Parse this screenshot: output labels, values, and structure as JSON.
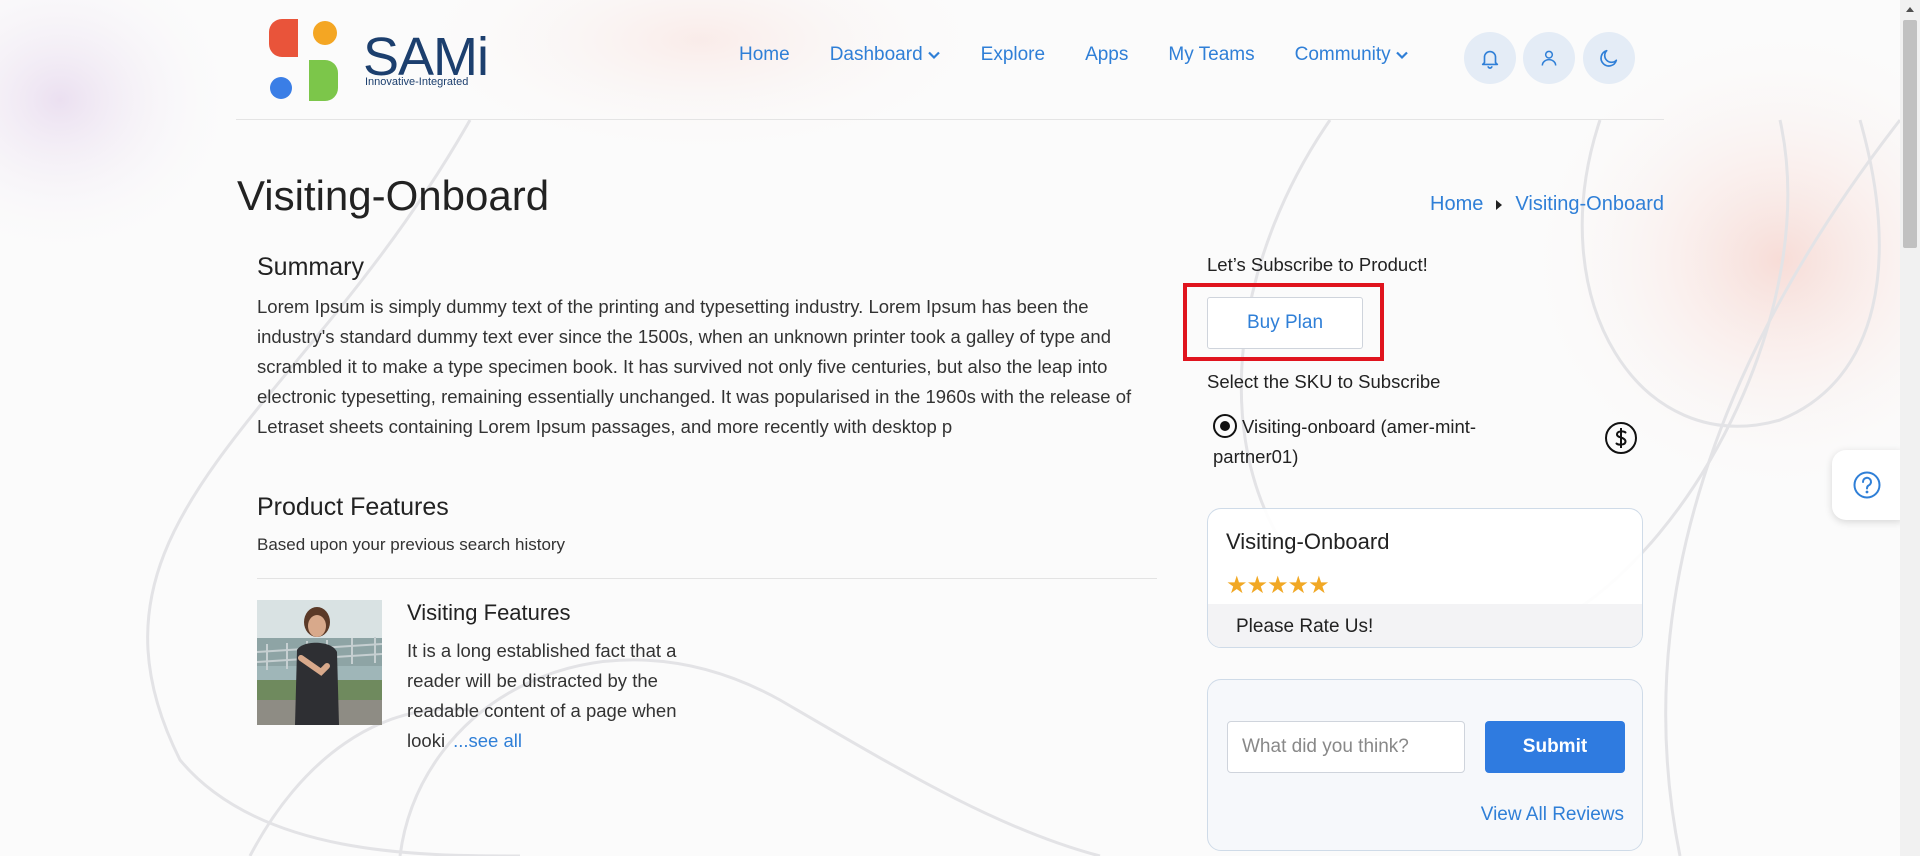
{
  "header": {
    "brand": "SAMi",
    "tagline": "Innovative-Integrated",
    "nav": [
      {
        "label": "Home"
      },
      {
        "label": "Dashboard"
      },
      {
        "label": "Explore"
      },
      {
        "label": "Apps"
      },
      {
        "label": "My Teams"
      },
      {
        "label": "Community"
      }
    ],
    "icons": [
      "bell-icon",
      "user-icon",
      "moon-icon"
    ]
  },
  "page": {
    "title": "Visiting-Onboard",
    "breadcrumb": [
      "Home",
      "Visiting-Onboard"
    ]
  },
  "summary": {
    "heading": "Summary",
    "text": "Lorem Ipsum is simply dummy text of the printing and typesetting industry. Lorem Ipsum has been the industry's standard dummy text ever since the 1500s, when an unknown printer took a galley of type and scrambled it to make a type specimen book. It has survived not only five centuries, but also the leap into electronic typesetting, remaining essentially unchanged. It was popularised in the 1960s with the release of Letraset sheets containing Lorem Ipsum passages, and more recently with desktop p"
  },
  "features": {
    "heading": "Product Features",
    "subheading": "Based upon your previous search history",
    "items": [
      {
        "title": "Visiting Features",
        "text": "It is a long established fact that a reader will be distracted by the readable content of a page when looki",
        "link": "...see all"
      }
    ]
  },
  "subscribe": {
    "label": "Let’s Subscribe to Product!",
    "buy_label": "Buy Plan",
    "sku_label": "Select the SKU to Subscribe",
    "sku_option": "Visiting-onboard (amer-mint-partner01)"
  },
  "rating": {
    "title": "Visiting-Onboard",
    "stars": "★★★★★",
    "rate_label": "Please Rate Us!"
  },
  "review": {
    "placeholder": "What did you think?",
    "submit_label": "Submit",
    "view_all_label": "View All Reviews"
  },
  "colors": {
    "accent": "#2f7fd7",
    "button": "#2f7be0",
    "highlight": "#e0141e",
    "star": "#f1a825"
  }
}
